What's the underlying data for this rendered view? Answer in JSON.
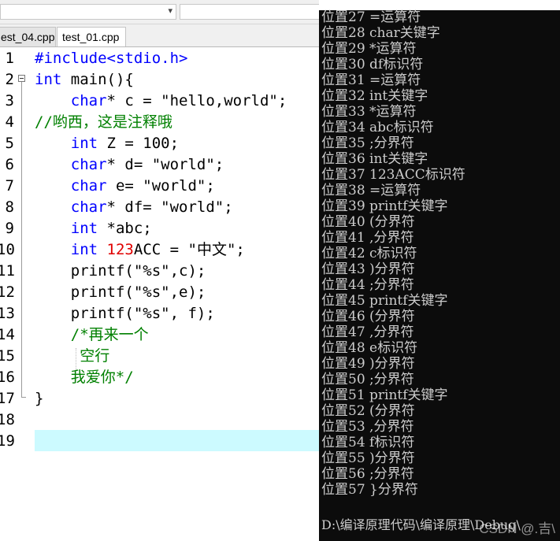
{
  "tabs": [
    {
      "label": "est_04.cpp",
      "active": false
    },
    {
      "label": "test_01.cpp",
      "active": true
    }
  ],
  "editor": {
    "lines": [
      {
        "num": "1",
        "html_parts": [
          [
            "pp",
            "#include<stdio.h>"
          ]
        ]
      },
      {
        "num": "2",
        "html_parts": [
          [
            "kw",
            "int"
          ],
          [
            "",
            " main(){"
          ]
        ]
      },
      {
        "num": "3",
        "html_parts": [
          [
            "",
            "    "
          ],
          [
            "kw",
            "char"
          ],
          [
            "",
            "* c = \"hello,world\";"
          ]
        ]
      },
      {
        "num": "4",
        "html_parts": [
          [
            "cmt",
            "//哟西，这是注释哦"
          ]
        ]
      },
      {
        "num": "5",
        "html_parts": [
          [
            "",
            "    "
          ],
          [
            "kw",
            "int"
          ],
          [
            "",
            " Z = 100;"
          ]
        ]
      },
      {
        "num": "6",
        "html_parts": [
          [
            "",
            "    "
          ],
          [
            "kw",
            "char"
          ],
          [
            "",
            "* d= \"world\";"
          ]
        ]
      },
      {
        "num": "7",
        "html_parts": [
          [
            "",
            "    "
          ],
          [
            "kw",
            "char"
          ],
          [
            "",
            " e= \"world\";"
          ]
        ]
      },
      {
        "num": "8",
        "html_parts": [
          [
            "",
            "    "
          ],
          [
            "kw",
            "char"
          ],
          [
            "",
            "* df= \"world\";"
          ]
        ]
      },
      {
        "num": "9",
        "html_parts": [
          [
            "",
            "    "
          ],
          [
            "kw",
            "int"
          ],
          [
            "",
            " *abc;"
          ]
        ]
      },
      {
        "num": "10",
        "html_parts": [
          [
            "",
            "    "
          ],
          [
            "kw",
            "int"
          ],
          [
            "",
            " "
          ],
          [
            "num",
            "123"
          ],
          [
            "",
            "ACC = \"中文\";"
          ]
        ]
      },
      {
        "num": "11",
        "html_parts": [
          [
            "",
            "    printf(\"%s\",c);"
          ]
        ]
      },
      {
        "num": "12",
        "html_parts": [
          [
            "",
            "    printf(\"%s\",e);"
          ]
        ]
      },
      {
        "num": "13",
        "html_parts": [
          [
            "",
            "    printf(\"%s\", f);"
          ]
        ]
      },
      {
        "num": "14",
        "html_parts": [
          [
            "",
            "    "
          ],
          [
            "cmt",
            "/*再来一个"
          ]
        ]
      },
      {
        "num": "15",
        "html_parts": [
          [
            "",
            "     "
          ],
          [
            "cmt",
            "空行"
          ]
        ]
      },
      {
        "num": "16",
        "html_parts": [
          [
            "",
            "    "
          ],
          [
            "cmt",
            "我爱你*/"
          ]
        ]
      },
      {
        "num": "17",
        "html_parts": [
          [
            "",
            "}"
          ]
        ]
      },
      {
        "num": "18",
        "html_parts": []
      },
      {
        "num": "19",
        "html_parts": []
      }
    ]
  },
  "console": {
    "lines": [
      "位置27 =运算符",
      "位置28 char关键字",
      "位置29 *运算符",
      "位置30 df标识符",
      "位置31 =运算符",
      "位置32 int关键字",
      "位置33 *运算符",
      "位置34 abc标识符",
      "位置35 ;分界符",
      "位置36 int关键字",
      "位置37 123ACC标识符",
      "位置38 =运算符",
      "位置39 printf关键字",
      "位置40 (分界符",
      "位置41 ,分界符",
      "位置42 c标识符",
      "位置43 )分界符",
      "位置44 ;分界符",
      "位置45 printf关键字",
      "位置46 (分界符",
      "位置47 ,分界符",
      "位置48 e标识符",
      "位置49 )分界符",
      "位置50 ;分界符",
      "位置51 printf关键字",
      "位置52 (分界符",
      "位置53 ,分界符",
      "位置54 f标识符",
      "位置55 )分界符",
      "位置56 ;分界符",
      "位置57 }分界符"
    ],
    "path": "D:\\编译原理代码\\编译原理\\Debug\\",
    "watermark": "CSDN @.吉\\"
  },
  "colors": {
    "keyword": "#0000ff",
    "comment": "#008000",
    "number": "#e00000",
    "current_line": "#ccfaff",
    "console_bg": "#0c0c0c",
    "console_text": "#cccccc"
  }
}
